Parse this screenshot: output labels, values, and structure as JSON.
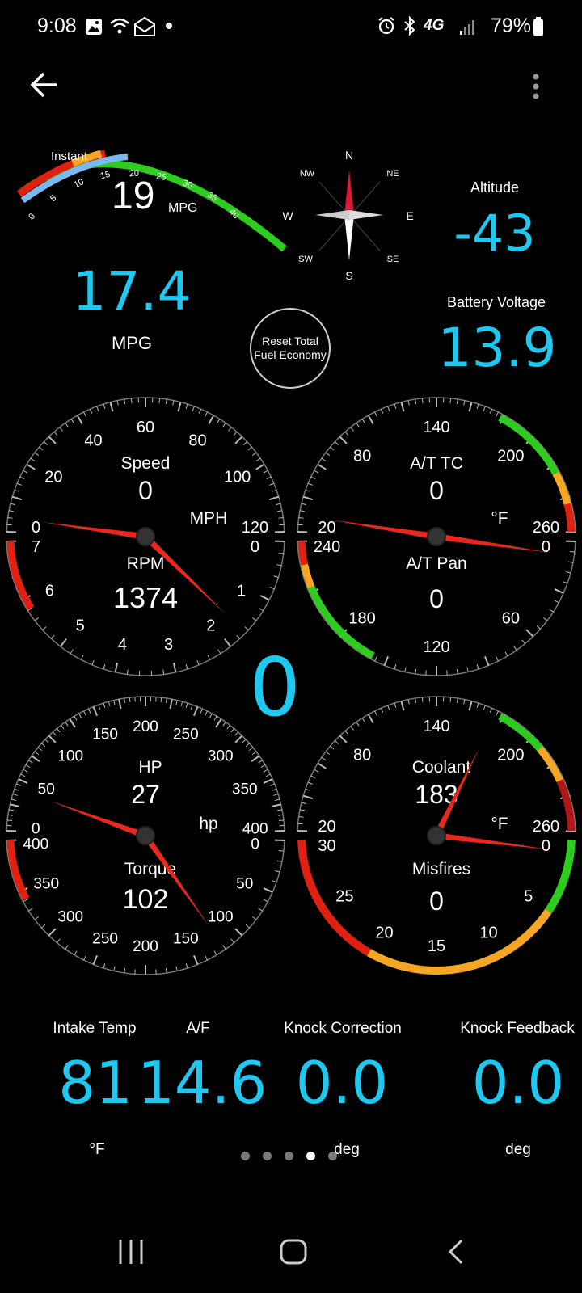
{
  "status_bar": {
    "time": "9:08",
    "network": "4G",
    "battery": "79%"
  },
  "fuel_gauge": {
    "label": "Instant",
    "value": "19",
    "unit": "MPG",
    "ticks": [
      "0",
      "5",
      "10",
      "15",
      "20",
      "25",
      "30",
      "35",
      "40"
    ],
    "current_mpg": 19
  },
  "compass": {
    "n": "N",
    "ne": "NE",
    "e": "E",
    "se": "SE",
    "s": "S",
    "sw": "SW",
    "w": "W",
    "nw": "NW"
  },
  "altitude": {
    "label": "Altitude",
    "value": "-43"
  },
  "average_mpg": {
    "value": "17.4",
    "unit": "MPG"
  },
  "reset_button": {
    "line1": "Reset Total",
    "line2": "Fuel Economy"
  },
  "battery_voltage": {
    "label": "Battery Voltage",
    "value": "13.9"
  },
  "speed_rpm_gauge": {
    "speed_label": "Speed",
    "speed_value": "0",
    "speed_unit": "MPH",
    "speed_ticks": [
      "0",
      "20",
      "40",
      "60",
      "80",
      "100",
      "120"
    ],
    "rpm_label": "RPM",
    "rpm_value": "1374",
    "rpm_ticks": [
      "0",
      "1",
      "2",
      "3",
      "4",
      "5",
      "6",
      "7"
    ]
  },
  "transmission_gauge": {
    "tc_label": "A/T TC",
    "tc_value": "0",
    "tc_unit": "°F",
    "tc_ticks": [
      "20",
      "80",
      "140",
      "200",
      "260"
    ],
    "pan_label": "A/T Pan",
    "pan_value": "0",
    "pan_ticks": [
      "0",
      "60",
      "120",
      "180",
      "240"
    ]
  },
  "center_value": "0",
  "hp_torque_gauge": {
    "hp_label": "HP",
    "hp_value": "27",
    "hp_unit": "hp",
    "hp_ticks": [
      "0",
      "50",
      "100",
      "150",
      "200",
      "250",
      "300",
      "350",
      "400"
    ],
    "torque_label": "Torque",
    "torque_value": "102",
    "torque_ticks": [
      "0",
      "50",
      "100",
      "150",
      "200",
      "250",
      "300",
      "350",
      "400"
    ]
  },
  "coolant_misfire_gauge": {
    "coolant_label": "Coolant",
    "coolant_value": "183",
    "coolant_unit": "°F",
    "coolant_ticks": [
      "20",
      "80",
      "140",
      "200",
      "260"
    ],
    "misfire_label": "Misfires",
    "misfire_value": "0",
    "misfire_ticks": [
      "0",
      "5",
      "10",
      "15",
      "20",
      "25",
      "30"
    ]
  },
  "bottom_readouts": {
    "intake_label": "Intake  Temp",
    "intake_value": "81",
    "intake_unit": "°F",
    "af_label": "A/F",
    "af_value": "14.6",
    "knock_corr_label": "Knock Correction",
    "knock_corr_value": "0.0",
    "knock_corr_unit": "deg",
    "knock_fb_label": "Knock Feedback",
    "knock_fb_value": "0.0",
    "knock_fb_unit": "deg"
  },
  "page_indicator": {
    "count": 5,
    "active": 4
  },
  "colors": {
    "accent": "#1ec8f0",
    "needle": "#e8281e",
    "green": "#2ecc1f",
    "orange": "#f5a623",
    "red": "#e02010"
  }
}
